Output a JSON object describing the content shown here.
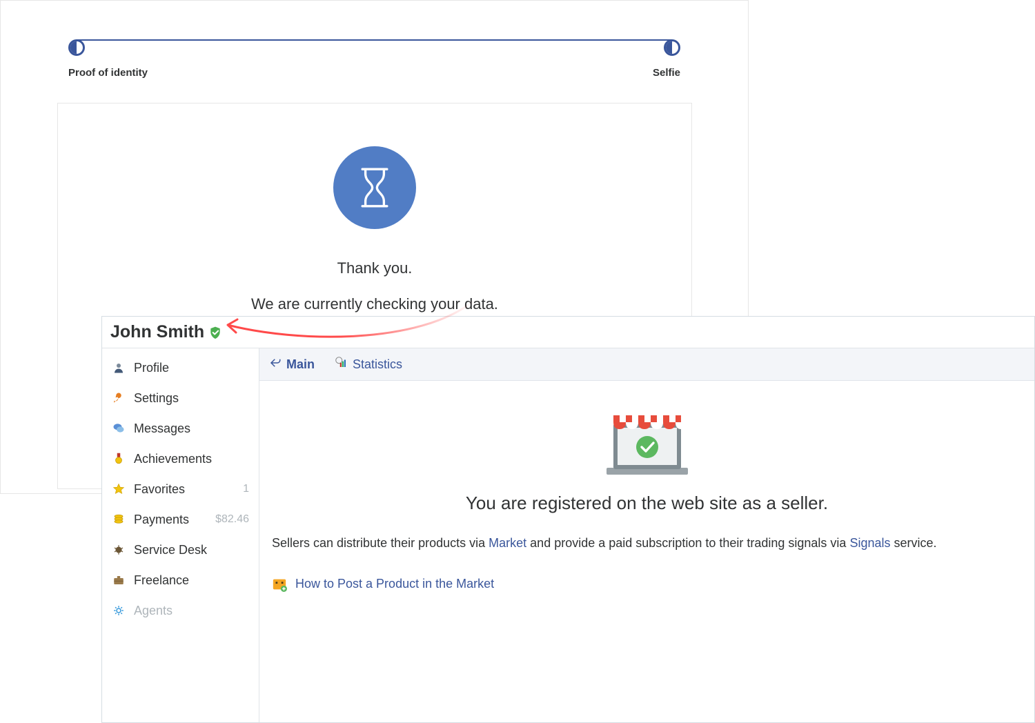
{
  "progress": {
    "step_left": "Proof of identity",
    "step_right": "Selfie"
  },
  "verification": {
    "title": "Thank you.",
    "subtitle": "We are currently checking your data."
  },
  "profile": {
    "name": "John Smith"
  },
  "sidebar": {
    "items": [
      {
        "label": "Profile",
        "badge": ""
      },
      {
        "label": "Settings",
        "badge": ""
      },
      {
        "label": "Messages",
        "badge": ""
      },
      {
        "label": "Achievements",
        "badge": ""
      },
      {
        "label": "Favorites",
        "badge": "1"
      },
      {
        "label": "Payments",
        "badge": "$82.46"
      },
      {
        "label": "Service Desk",
        "badge": ""
      },
      {
        "label": "Freelance",
        "badge": ""
      },
      {
        "label": "Agents",
        "badge": ""
      }
    ]
  },
  "tabs": {
    "main": "Main",
    "statistics": "Statistics"
  },
  "content": {
    "registered": "You are registered on the web site as a seller.",
    "desc_pre": "Sellers can distribute their products via ",
    "link_market": "Market",
    "desc_mid": " and provide a paid subscription to their trading signals via ",
    "link_signals": "Signals",
    "desc_post": " service.",
    "howto_link": "How to Post a Product in the Market"
  }
}
